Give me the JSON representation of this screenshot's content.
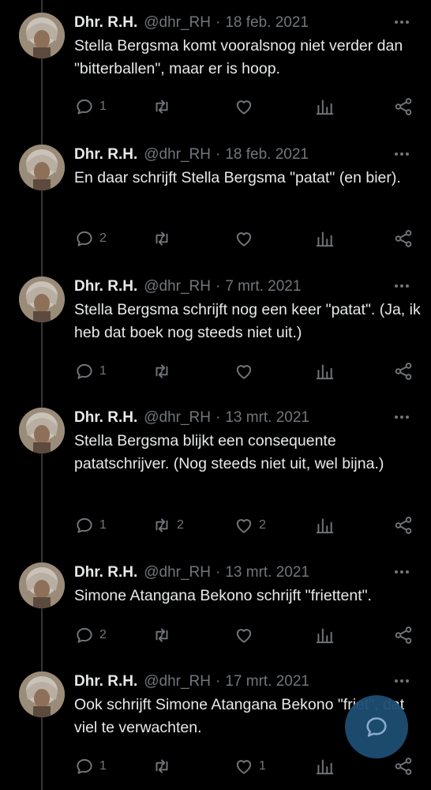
{
  "tweets": [
    {
      "name": "Dhr. R.H.",
      "handle": "@dhr_RH",
      "sep": "·",
      "date": "18 feb. 2021",
      "text": "Stella Bergsma komt vooralsnog niet verder dan \"bitterballen\", maar er is hoop.",
      "replies": "1",
      "retweets": "",
      "likes": ""
    },
    {
      "name": "Dhr. R.H.",
      "handle": "@dhr_RH",
      "sep": "·",
      "date": "18 feb. 2021",
      "text": "En daar schrijft Stella Bergsma \"patat\" (en bier).",
      "replies": "2",
      "retweets": "",
      "likes": ""
    },
    {
      "name": "Dhr. R.H.",
      "handle": "@dhr_RH",
      "sep": "·",
      "date": "7 mrt. 2021",
      "text": "Stella Bergsma schrijft nog een keer \"patat\". (Ja, ik heb dat boek nog steeds niet uit.)",
      "replies": "1",
      "retweets": "",
      "likes": ""
    },
    {
      "name": "Dhr. R.H.",
      "handle": "@dhr_RH",
      "sep": "·",
      "date": "13 mrt. 2021",
      "text": "Stella Bergsma blijkt een consequente patatschrijver. (Nog steeds niet uit, wel bijna.)",
      "replies": "1",
      "retweets": "2",
      "likes": "2"
    },
    {
      "name": "Dhr. R.H.",
      "handle": "@dhr_RH",
      "sep": "·",
      "date": "13 mrt. 2021",
      "text": "Simone Atangana Bekono schrijft \"friettent\".",
      "replies": "2",
      "retweets": "",
      "likes": ""
    },
    {
      "name": "Dhr. R.H.",
      "handle": "@dhr_RH",
      "sep": "·",
      "date": "17 mrt. 2021",
      "text": "Ook schrijft Simone Atangana Bekono \"friet\", dat viel te verwachten.",
      "replies": "1",
      "retweets": "",
      "likes": "1"
    }
  ],
  "icons": {
    "reply": "reply-icon",
    "retweet": "retweet-icon",
    "like": "heart-icon",
    "views": "views-icon",
    "share": "share-icon",
    "more": "more-icon",
    "fab": "compose-reply-icon"
  },
  "colors": {
    "background": "#000000",
    "text": "#e7e9ea",
    "muted": "#71767b",
    "fab": "#1d4e73"
  }
}
